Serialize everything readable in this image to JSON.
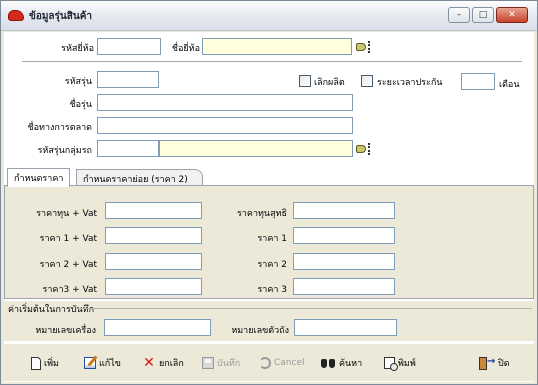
{
  "window": {
    "title": "ข้อมูลรุ่นสินค้า",
    "minimize_glyph": "–",
    "maximize_glyph": "□",
    "close_glyph": "✕"
  },
  "header": {
    "brand_code_label": "รหัสยี่ห้อ",
    "brand_code_value": "",
    "brand_name_label": "ชื่อยี่ห้อ",
    "brand_name_value": ""
  },
  "model": {
    "model_code_label": "รหัสรุ่น",
    "model_code_value": "",
    "discontinued_label": "เลิกผลิต",
    "warranty_label": "ระยะเวลาประกัน",
    "warranty_value": "",
    "warranty_unit": "เดือน",
    "model_name_label": "ชื่อรุ่น",
    "model_name_value": "",
    "marketing_name_label": "ชื่อทางการตลาด",
    "marketing_name_value": "",
    "model_group_label": "รหัสรุ่นกลุ่มรถ",
    "model_group_code_value": "",
    "model_group_name_value": ""
  },
  "tabs": [
    {
      "label": "กำหนดราคา"
    },
    {
      "label": "กำหนดราคาย่อย (ราคา 2)"
    }
  ],
  "pricing": {
    "cost_vat_label": "ราคาทุน + Vat",
    "net_cost_label": "ราคาทุนสุทธิ",
    "price1_vat_label": "ราคา 1 + Vat",
    "price1_label": "ราคา 1",
    "price2_vat_label": "ราคา 2 + Vat",
    "price2_label": "ราคา 2",
    "price3_vat_label": "ราคา3 + Vat",
    "price3_label": "ราคา 3"
  },
  "record_start": {
    "title": "ค่าเริ่มต้นในการบันทึก",
    "machine_no_label": "หมายเลขเครื่อง",
    "chassis_no_label": "หมายเลขตัวถัง"
  },
  "toolbar": {
    "add_label": "เพิ่ม",
    "edit_label": "แก้ไข",
    "cancel_item_label": "ยกเลิก",
    "save_label": "บันทึก",
    "cancel_label": "Cancel",
    "search_label": "ค้นหา",
    "print_label": "พิมพ์",
    "close_label": "ปิด"
  }
}
